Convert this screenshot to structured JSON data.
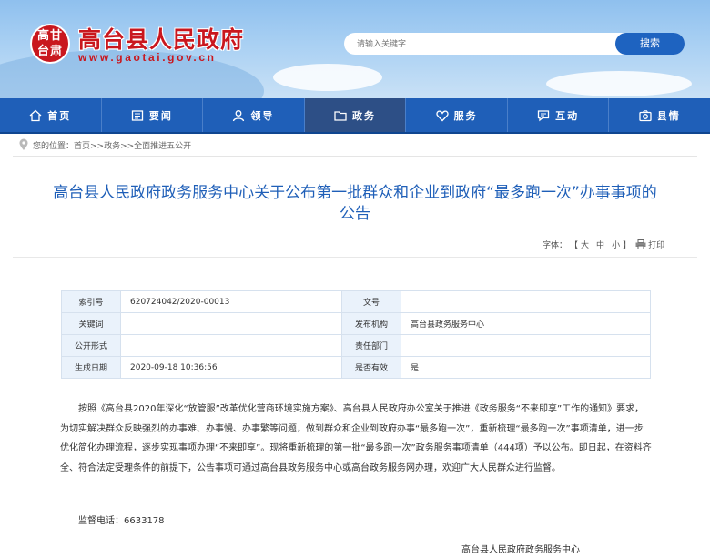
{
  "header": {
    "logo_lines": [
      "高甘",
      "台肃"
    ],
    "site_title": "高台县人民政府",
    "site_url": "www.gaotai.gov.cn",
    "search": {
      "placeholder": "请输入关键字",
      "button": "搜索"
    }
  },
  "nav": [
    {
      "label": "首页",
      "icon": "home-icon"
    },
    {
      "label": "要闻",
      "icon": "news-icon"
    },
    {
      "label": "领导",
      "icon": "person-icon"
    },
    {
      "label": "政务",
      "icon": "folder-icon",
      "active": true
    },
    {
      "label": "服务",
      "icon": "heart-icon"
    },
    {
      "label": "互动",
      "icon": "chat-icon"
    },
    {
      "label": "县情",
      "icon": "camera-icon"
    }
  ],
  "breadcrumb": {
    "prefix": "您的位置：",
    "path": "首页>>政务>>全面推进五公开"
  },
  "article": {
    "title_line1": "高台县人民政府政务服务中心关于公布第一批群众和企业到政府“最多跑一次”办事事项的",
    "title_line2": "公告",
    "font_label": "字体：",
    "font_large": "大",
    "font_medium": "中",
    "font_small": "小",
    "print_label": "打印"
  },
  "meta_table": [
    {
      "label1": "索引号",
      "value1": "620724042/2020-00013",
      "label2": "文号",
      "value2": ""
    },
    {
      "label1": "关键词",
      "value1": "",
      "label2": "发布机构",
      "value2": "高台县政务服务中心"
    },
    {
      "label1": "公开形式",
      "value1": "",
      "label2": "责任部门",
      "value2": ""
    },
    {
      "label1": "生成日期",
      "value1": "2020-09-18 10:36:56",
      "label2": "是否有效",
      "value2": "是"
    }
  ],
  "body": {
    "paragraph": "按照《高台县2020年深化“放管服”改革优化营商环境实施方案》、高台县人民政府办公室关于推进《政务服务“不来即享”工作的通知》要求，为切实解决群众反映强烈的办事难、办事慢、办事繁等问题，做到群众和企业到政府办事“最多跑一次”，重新梳理“最多跑一次”事项清单，进一步优化简化办理流程，逐步实现事项办理“不来即享”。现将重新梳理的第一批“最多跑一次”政务服务事项清单（444项）予以公布。即日起，在资料齐全、符合法定受理条件的前提下，公告事项可通过高台县政务服务中心或高台政务服务网办理，欢迎广大人民群众进行监督。",
    "phone": "监督电话：6633178",
    "signer": "高台县人民政府政务服务中心"
  }
}
